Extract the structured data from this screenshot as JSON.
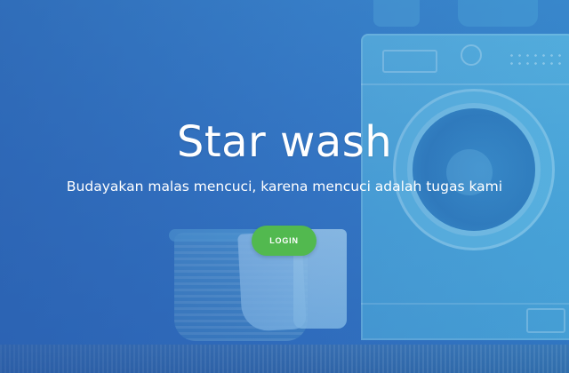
{
  "hero": {
    "title": "Star wash",
    "subtitle": "Budayakan malas mencuci, karena mencuci adalah tugas kami",
    "login_label": "LOGIN"
  },
  "colors": {
    "overlay": "#3572c0",
    "button": "#52b94f",
    "text": "#ffffff"
  },
  "background": {
    "icon": "washing-machine-icon",
    "secondary_icon": "laundry-basket-icon"
  }
}
